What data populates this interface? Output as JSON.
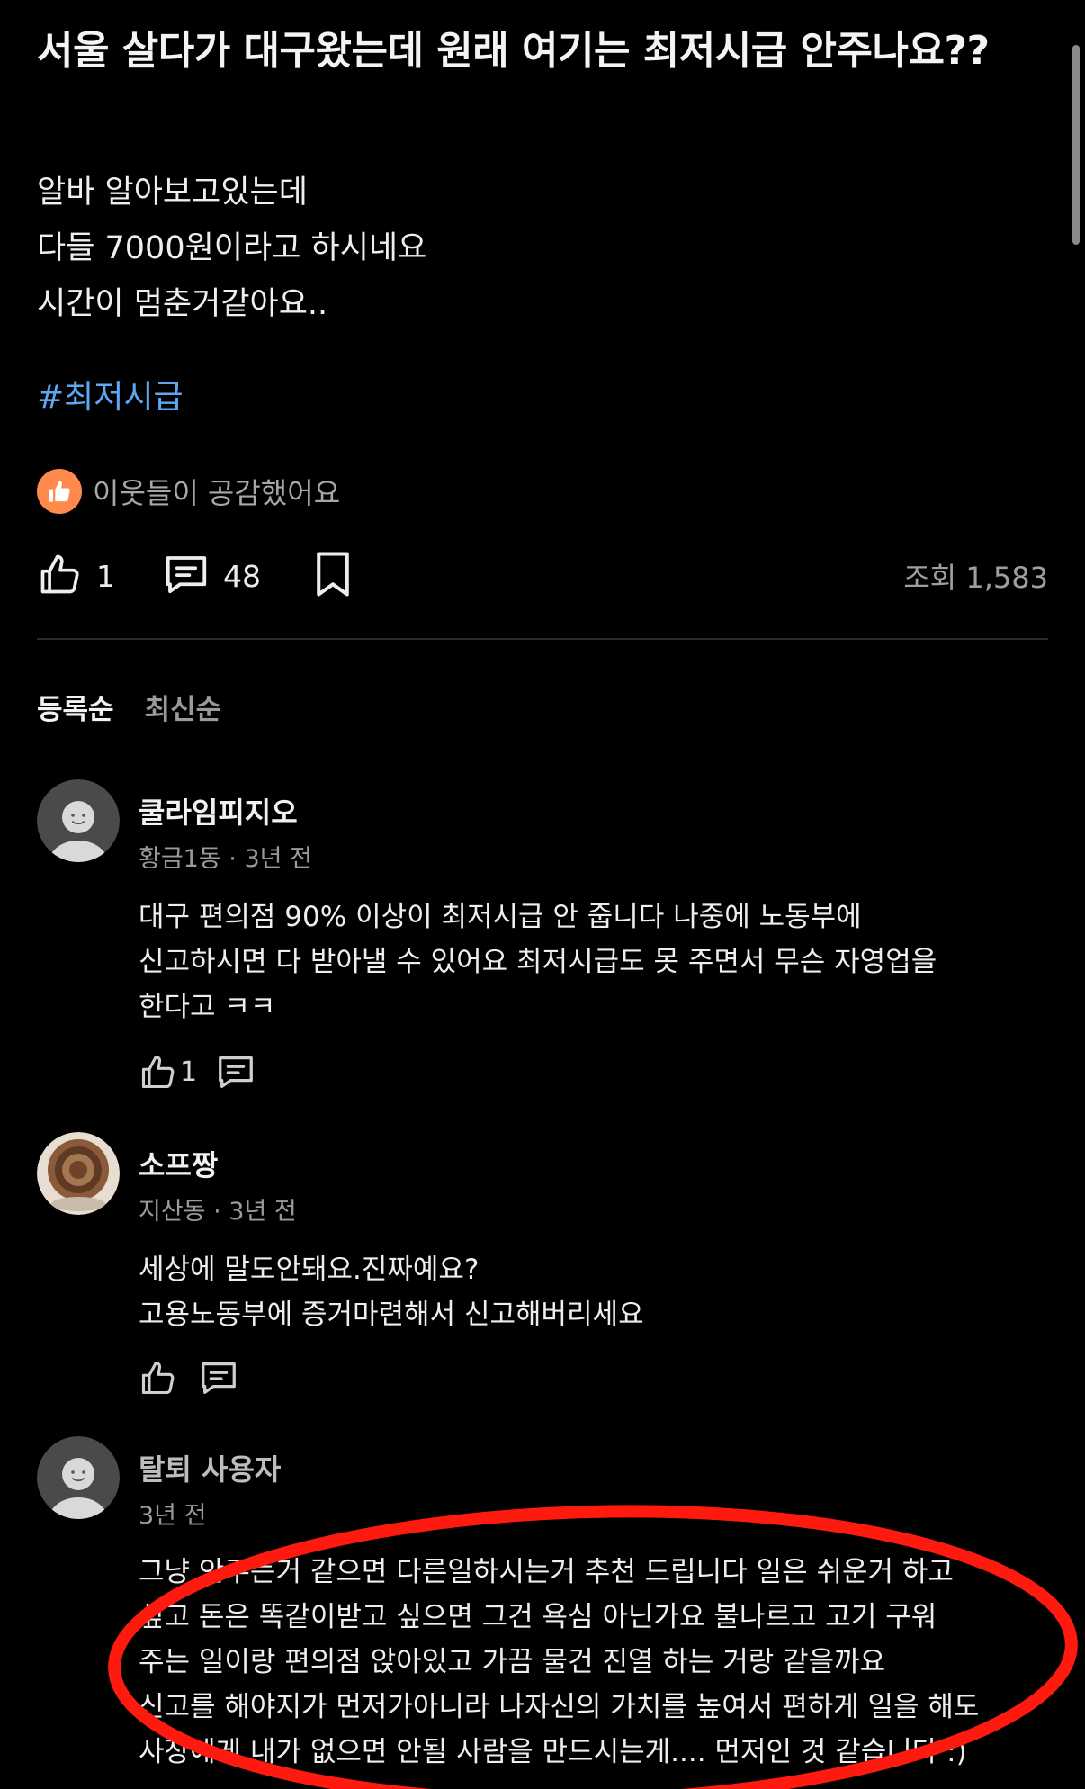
{
  "post": {
    "title": "서울 살다가 대구왔는데 원래 여기는 최저시급 안주나요??",
    "body_lines": [
      "알바 알아보고있는데",
      "다들 7000원이라고 하시네요",
      "시간이 멈춘거같아요.."
    ],
    "hashtag": "#최저시급",
    "reaction_text": "이웃들이 공감했어요",
    "reaction_icon": "thumbs-up-icon",
    "like_count": "1",
    "comment_count": "48",
    "views_text": "조회 1,583"
  },
  "sort_tabs": [
    {
      "label": "등록순",
      "active": true
    },
    {
      "label": "최신순",
      "active": false
    }
  ],
  "comments": [
    {
      "name": "쿨라임피지오",
      "meta": "황금1동 · 3년 전",
      "lines": [
        "대구 편의점 90% 이상이 최저시급 안 줍니다 나중에 노동부에",
        "신고하시면 다 받아낼 수 있어요 최저시급도 못 주면서 무슨 자영업을",
        "한다고 ㅋㅋ"
      ],
      "like_count": "1"
    },
    {
      "name": "소프짱",
      "meta": "지산동 · 3년 전",
      "lines": [
        "세상에 말도안돼요.진짜예요?",
        "고용노동부에 증거마련해서 신고해버리세요"
      ],
      "like_count": ""
    },
    {
      "name": "탈퇴 사용자",
      "meta": "3년 전",
      "lines": [
        "그냥 안주는거 같으면 다른일하시는거 추천 드립니다 일은 쉬운거 하고",
        "싶고 돈은 똑같이받고 싶으면 그건 욕심 아닌가요 불나르고 고기 구워",
        "주는 일이랑 편의점 앉아있고 가끔 물건 진열 하는 거랑 같을까요",
        "신고를 해야지가 먼저가아니라 나자신의 가치를 높여서 편하게 일을 해도",
        "사장에게 내가 없으면 안될 사람을 만드시는게.... 먼저인 것 같습니다 :)"
      ],
      "like_count": ""
    }
  ],
  "colors": {
    "background": "#000000",
    "hashtag": "#5da8f3",
    "reaction_badge": "#ff8a4c",
    "annotation_red": "#ff1a0f"
  }
}
